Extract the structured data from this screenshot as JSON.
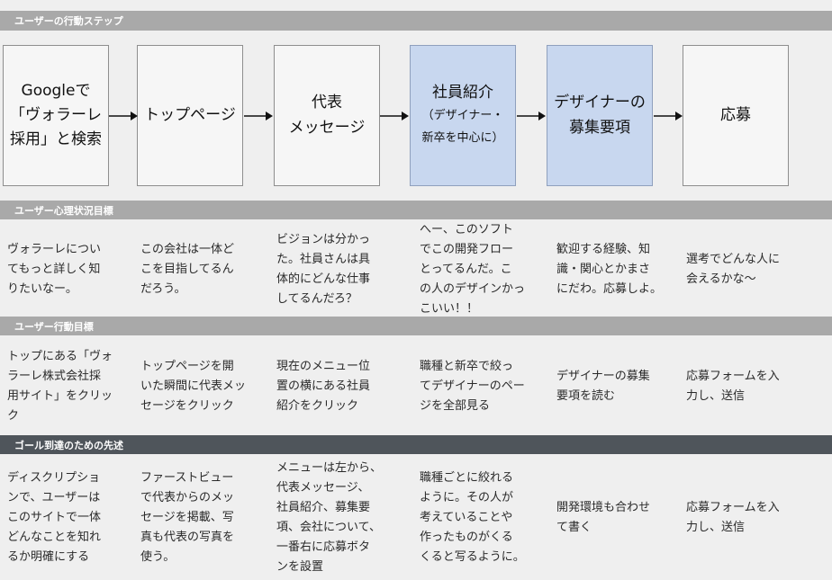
{
  "bands": {
    "steps_title": "ユーザーの行動ステップ",
    "mind_title": "ユーザー心理状況目標",
    "action_title": "ユーザー行動目標",
    "measures_title": "ゴール到達のための先述"
  },
  "steps": [
    {
      "line1": "Googleで",
      "line2": "「ヴォラーレ",
      "line3": "採用」と検索",
      "highlight": false
    },
    {
      "line1": "トップページ",
      "highlight": false
    },
    {
      "line1": "代表",
      "line2": "メッセージ",
      "highlight": false
    },
    {
      "line1": "社員紹介",
      "sub1": "（デザイナー・",
      "sub2": "新卒を中心に）",
      "highlight": true
    },
    {
      "line1": "デザイナーの",
      "line2": "募集要項",
      "highlight": true
    },
    {
      "line1": "応募",
      "highlight": false
    }
  ],
  "mind": [
    "ヴォラーレについ\nてもっと詳しく知\nりたいなー。",
    "この会社は一体ど\nこを目指してるん\nだろう。",
    "ビジョンは分かっ\nた。社員さんは具\n体的にどんな仕事\nしてるんだろ？",
    "へー、このソフト\nでこの開発フロー\nとってるんだ。こ\nの人のデザインかっ\nこいい！！",
    "歓迎する経験、知\n識・関心とかまさ\nにだわ。応募しよ。",
    "選考でどんな人に\n会えるかな〜"
  ],
  "action": [
    "トップにある「ヴォ\nラーレ株式会社採\n用サイト」をクリッ\nク",
    "トップページを開\nいた瞬間に代表メッ\nセージをクリック",
    "現在のメニュー位\n置の横にある社員\n紹介をクリック",
    "職種と新卒で絞っ\nてデザイナーのペー\nジを全部見る",
    "デザイナーの募集\n要項を読む",
    "応募フォームを入\n力し、送信"
  ],
  "measures": [
    "ディスクリプショ\nンで、ユーザーは\nこのサイトで一体\nどんなことを知れ\nるか明確にする",
    "ファーストビュー\nで代表からのメッ\nセージを掲載、写\n真も代表の写真を\n使う。",
    "メニューは左から、\n代表メッセージ、\n社員紹介、募集要\n項、会社について、\n一番右に応募ボタ\nンを設置",
    "職種ごとに絞れる\nように。その人が\n考えていることや\n作ったものがくる\nくると写るように。",
    "開発環境も合わせ\nて書く",
    "応募フォームを入\n力し、送信"
  ],
  "colors": {
    "highlight": "#c8d7ef",
    "band_gray": "#a9a9a9",
    "band_dark": "#4f555b"
  }
}
